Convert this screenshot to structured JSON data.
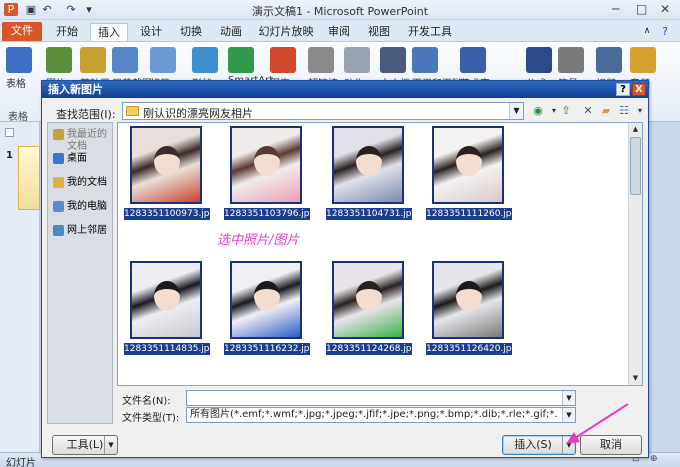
{
  "app": {
    "title": "演示文稿1 - Microsoft PowerPoint"
  },
  "quick_access": {
    "save_icon": "save-icon",
    "undo_icon": "undo-icon",
    "redo_icon": "redo-icon"
  },
  "tabs": [
    {
      "label": "文件"
    },
    {
      "label": "开始"
    },
    {
      "label": "插入"
    },
    {
      "label": "设计"
    },
    {
      "label": "切换"
    },
    {
      "label": "动画"
    },
    {
      "label": "幻灯片放映"
    },
    {
      "label": "审阅"
    },
    {
      "label": "视图"
    },
    {
      "label": "开发工具"
    }
  ],
  "ribbon": {
    "items": [
      {
        "label": "表格",
        "color": "#3c6fc4"
      },
      {
        "label": "图片",
        "color": "#5c8f3c"
      },
      {
        "label": "剪贴画",
        "color": "#c8a030"
      },
      {
        "label": "屏幕截图",
        "color": "#5586c8"
      },
      {
        "label": "相册",
        "color": "#6a9ad4"
      },
      {
        "label": "形状",
        "color": "#3e8fd0"
      },
      {
        "label": "SmartArt",
        "color": "#2e9a4a"
      },
      {
        "label": "图表",
        "color": "#d04a2a"
      },
      {
        "label": "超链接",
        "color": "#8a8a8a"
      },
      {
        "label": "动作",
        "color": "#9aa4b0"
      },
      {
        "label": "文本框",
        "color": "#4a5a7a"
      },
      {
        "label": "页眉和页脚",
        "color": "#4a78b8"
      },
      {
        "label": "艺术字",
        "color": "#3a5ea8"
      },
      {
        "label": "公式",
        "color": "#2a4a8a"
      },
      {
        "label": "符号",
        "color": "#7a7a7a"
      },
      {
        "label": "视频",
        "color": "#4a6a9a"
      },
      {
        "label": "音频",
        "color": "#d8a030"
      }
    ],
    "group_label": "表格"
  },
  "left_pane": {
    "slide_number": "1"
  },
  "status_bar": {
    "label": "幻灯片"
  },
  "dialog": {
    "title": "插入新图片",
    "help_label": "?",
    "close_label": "X",
    "look_in_label": "查找范围(I):",
    "look_in_value": "刚认识的漂亮网友相片",
    "places": [
      {
        "label": "我最近的文档",
        "icon": "recent-docs-icon",
        "color": "#c9a040"
      },
      {
        "label": "桌面",
        "icon": "desktop-icon",
        "color": "#3a78c8"
      },
      {
        "label": "我的文档",
        "icon": "my-documents-icon",
        "color": "#e0b040"
      },
      {
        "label": "我的电脑",
        "icon": "my-computer-icon",
        "color": "#5a8ad0"
      },
      {
        "label": "网上邻居",
        "icon": "network-icon",
        "color": "#4a8ac0"
      }
    ],
    "files": [
      {
        "name": "1283351100973.jpg",
        "c1": "#e8e0d8",
        "c2": "#3a2a2a",
        "c3": "#c8402a"
      },
      {
        "name": "1283351103796.jpg",
        "c1": "#f0ecec",
        "c2": "#5a3a30",
        "c3": "#e8a0b0"
      },
      {
        "name": "1283351104731.jpg",
        "c1": "#e0e0e8",
        "c2": "#2a2020",
        "c3": "#7a8ab0"
      },
      {
        "name": "1283351111260.jpg",
        "c1": "#f4f2f2",
        "c2": "#2a2222",
        "c3": "#d8c8c8"
      },
      {
        "name": "1283351114835.jpg",
        "c1": "#eceef2",
        "c2": "#1a1a20",
        "c3": "#c8c8d0"
      },
      {
        "name": "1283351116232.jpg",
        "c1": "#eef0f4",
        "c2": "#1a1a22",
        "c3": "#2a5ac8"
      },
      {
        "name": "1283351124268.jpg",
        "c1": "#e8e4ea",
        "c2": "#2a2020",
        "c3": "#3ab04a"
      },
      {
        "name": "1283351126420.jpg",
        "c1": "#e6e6ea",
        "c2": "#1a1a1a",
        "c3": "#7a7a7a"
      }
    ],
    "annotation": "选中照片/图片",
    "filename_label": "文件名(N):",
    "filename_value": "",
    "filetype_label": "文件类型(T):",
    "filetype_value": "所有图片(*.emf;*.wmf;*.jpg;*.jpeg;*.jfif;*.jpe;*.png;*.bmp;*.dib;*.rle;*.gif;*.",
    "tools_button": "工具(L)",
    "insert_button": "插入(S)",
    "cancel_button": "取消"
  },
  "colors": {
    "accent": "#d9562a",
    "dialog_title": "#1a4fa0",
    "selection": "#1d3e8c",
    "annotation": "#e040c0"
  }
}
